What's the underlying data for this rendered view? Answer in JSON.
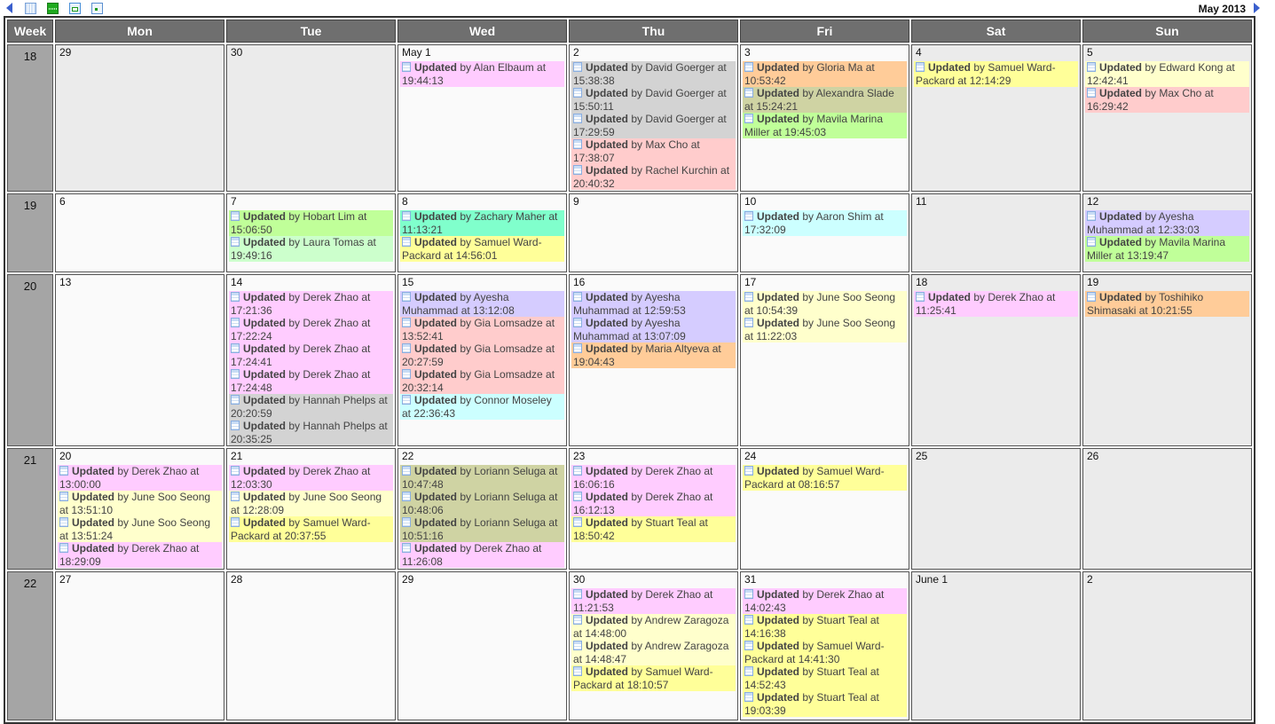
{
  "toolbar": {
    "prev_icon": "prev-month-arrow-icon",
    "next_icon": "next-month-arrow-icon",
    "view_icons": [
      "month-view-icon",
      "week-view-icon",
      "day-view-icon",
      "item-view-icon"
    ],
    "month_label": "May 2013"
  },
  "headers": [
    "Week",
    "Mon",
    "Tue",
    "Wed",
    "Thu",
    "Fri",
    "Sat",
    "Sun"
  ],
  "event_verb": "Updated",
  "colors": {
    "pink": "#ffccff",
    "gray": "#d3d3d3",
    "salmon": "#ffcccc",
    "orange": "#ffcc99",
    "olive": "#cfd3a3",
    "green": "#c0ff99",
    "yellow": "#ffff99",
    "lightyellow": "#ffffcc",
    "mint": "#ccffcc",
    "teal": "#80ffcc",
    "cyan": "#ccffff",
    "lavender": "#d5ccff"
  },
  "weeks": [
    {
      "week": "18",
      "days": [
        {
          "label": "29",
          "type": "other",
          "events": []
        },
        {
          "label": "30",
          "type": "other",
          "events": []
        },
        {
          "label": "May 1",
          "type": "day",
          "events": [
            {
              "text": " by Alan Elbaum at 19:44:13",
              "color": "pink"
            }
          ]
        },
        {
          "label": "2",
          "type": "day",
          "events": [
            {
              "text": " by David Goerger at 15:38:38",
              "color": "gray"
            },
            {
              "text": " by David Goerger at 15:50:11",
              "color": "gray"
            },
            {
              "text": " by David Goerger at 17:29:59",
              "color": "gray"
            },
            {
              "text": " by Max Cho at 17:38:07",
              "color": "salmon"
            },
            {
              "text": " by Rachel Kurchin at 20:40:32",
              "color": "salmon"
            }
          ]
        },
        {
          "label": "3",
          "type": "day",
          "events": [
            {
              "text": " by Gloria Ma at 10:53:42",
              "color": "orange"
            },
            {
              "text": " by Alexandra Slade at 15:24:21",
              "color": "olive"
            },
            {
              "text": " by Mavila Marina Miller at 19:45:03",
              "color": "green"
            }
          ]
        },
        {
          "label": "4",
          "type": "weekend",
          "events": [
            {
              "text": " by Samuel Ward-Packard at 12:14:29",
              "color": "yellow"
            }
          ]
        },
        {
          "label": "5",
          "type": "weekend",
          "events": [
            {
              "text": " by Edward Kong at 12:42:41",
              "color": "lightyellow"
            },
            {
              "text": " by Max Cho at 16:29:42",
              "color": "salmon"
            }
          ]
        }
      ]
    },
    {
      "week": "19",
      "days": [
        {
          "label": "6",
          "type": "day",
          "events": []
        },
        {
          "label": "7",
          "type": "day",
          "events": [
            {
              "text": " by Hobart Lim at 15:06:50",
              "color": "green"
            },
            {
              "text": " by Laura Tomas at 19:49:16",
              "color": "mint"
            }
          ]
        },
        {
          "label": "8",
          "type": "day",
          "events": [
            {
              "text": " by Zachary Maher at 11:13:21",
              "color": "teal"
            },
            {
              "text": " by Samuel Ward-Packard at 14:56:01",
              "color": "yellow"
            }
          ]
        },
        {
          "label": "9",
          "type": "day",
          "events": []
        },
        {
          "label": "10",
          "type": "day",
          "events": [
            {
              "text": " by Aaron Shim at 17:32:09",
              "color": "cyan"
            }
          ]
        },
        {
          "label": "11",
          "type": "weekend",
          "events": []
        },
        {
          "label": "12",
          "type": "weekend",
          "events": [
            {
              "text": " by Ayesha Muhammad at 12:33:03",
              "color": "lavender"
            },
            {
              "text": " by Mavila Marina Miller at 13:19:47",
              "color": "green"
            }
          ]
        }
      ]
    },
    {
      "week": "20",
      "days": [
        {
          "label": "13",
          "type": "day",
          "events": []
        },
        {
          "label": "14",
          "type": "day",
          "events": [
            {
              "text": " by Derek Zhao at 17:21:36",
              "color": "pink"
            },
            {
              "text": " by Derek Zhao at 17:22:24",
              "color": "pink"
            },
            {
              "text": " by Derek Zhao at 17:24:41",
              "color": "pink"
            },
            {
              "text": " by Derek Zhao at 17:24:48",
              "color": "pink"
            },
            {
              "text": " by Hannah Phelps at 20:20:59",
              "color": "gray"
            },
            {
              "text": " by Hannah Phelps at 20:35:25",
              "color": "gray"
            }
          ]
        },
        {
          "label": "15",
          "type": "day",
          "events": [
            {
              "text": " by Ayesha Muhammad at 13:12:08",
              "color": "lavender"
            },
            {
              "text": " by Gia Lomsadze at 13:52:41",
              "color": "salmon"
            },
            {
              "text": " by Gia Lomsadze at 20:27:59",
              "color": "salmon"
            },
            {
              "text": " by Gia Lomsadze at 20:32:14",
              "color": "salmon"
            },
            {
              "text": " by Connor Moseley at 22:36:43",
              "color": "cyan"
            }
          ]
        },
        {
          "label": "16",
          "type": "day",
          "events": [
            {
              "text": " by Ayesha Muhammad at 12:59:53",
              "color": "lavender"
            },
            {
              "text": " by Ayesha Muhammad at 13:07:09",
              "color": "lavender"
            },
            {
              "text": " by Maria Altyeva at 19:04:43",
              "color": "orange"
            }
          ]
        },
        {
          "label": "17",
          "type": "day",
          "events": [
            {
              "text": " by June Soo Seong at 10:54:39",
              "color": "lightyellow"
            },
            {
              "text": " by June Soo Seong at 11:22:03",
              "color": "lightyellow"
            }
          ]
        },
        {
          "label": "18",
          "type": "weekend",
          "events": [
            {
              "text": " by Derek Zhao at 11:25:41",
              "color": "pink"
            }
          ]
        },
        {
          "label": "19",
          "type": "weekend",
          "events": [
            {
              "text": " by Toshihiko Shimasaki at 10:21:55",
              "color": "orange"
            }
          ]
        }
      ]
    },
    {
      "week": "21",
      "days": [
        {
          "label": "20",
          "type": "day",
          "events": [
            {
              "text": " by Derek Zhao at 13:00:00",
              "color": "pink"
            },
            {
              "text": " by June Soo Seong at 13:51:10",
              "color": "lightyellow"
            },
            {
              "text": " by June Soo Seong at 13:51:24",
              "color": "lightyellow"
            },
            {
              "text": " by Derek Zhao at 18:29:09",
              "color": "pink"
            }
          ]
        },
        {
          "label": "21",
          "type": "day",
          "events": [
            {
              "text": " by Derek Zhao at 12:03:30",
              "color": "pink"
            },
            {
              "text": " by June Soo Seong at 12:28:09",
              "color": "lightyellow"
            },
            {
              "text": " by Samuel Ward-Packard at 20:37:55",
              "color": "yellow"
            }
          ]
        },
        {
          "label": "22",
          "type": "day",
          "events": [
            {
              "text": " by Loriann Seluga at 10:47:48",
              "color": "olive"
            },
            {
              "text": " by Loriann Seluga at 10:48:06",
              "color": "olive"
            },
            {
              "text": " by Loriann Seluga at 10:51:16",
              "color": "olive"
            },
            {
              "text": " by Derek Zhao at 11:26:08",
              "color": "pink"
            }
          ]
        },
        {
          "label": "23",
          "type": "day",
          "events": [
            {
              "text": " by Derek Zhao at 16:06:16",
              "color": "pink"
            },
            {
              "text": " by Derek Zhao at 16:12:13",
              "color": "pink"
            },
            {
              "text": " by Stuart Teal at 18:50:42",
              "color": "yellow"
            }
          ]
        },
        {
          "label": "24",
          "type": "day",
          "events": [
            {
              "text": " by Samuel Ward-Packard at 08:16:57",
              "color": "yellow"
            }
          ]
        },
        {
          "label": "25",
          "type": "weekend",
          "events": []
        },
        {
          "label": "26",
          "type": "weekend",
          "events": []
        }
      ]
    },
    {
      "week": "22",
      "days": [
        {
          "label": "27",
          "type": "day",
          "events": []
        },
        {
          "label": "28",
          "type": "day",
          "events": []
        },
        {
          "label": "29",
          "type": "day",
          "events": []
        },
        {
          "label": "30",
          "type": "day",
          "events": [
            {
              "text": " by Derek Zhao at 11:21:53",
              "color": "pink"
            },
            {
              "text": " by Andrew Zaragoza at 14:48:00",
              "color": "lightyellow"
            },
            {
              "text": " by Andrew Zaragoza at 14:48:47",
              "color": "lightyellow"
            },
            {
              "text": " by Samuel Ward-Packard at 18:10:57",
              "color": "yellow"
            }
          ]
        },
        {
          "label": "31",
          "type": "day",
          "events": [
            {
              "text": " by Derek Zhao at 14:02:43",
              "color": "pink"
            },
            {
              "text": " by Stuart Teal at 14:16:38",
              "color": "yellow"
            },
            {
              "text": " by Samuel Ward-Packard at 14:41:30",
              "color": "yellow"
            },
            {
              "text": " by Stuart Teal at 14:52:43",
              "color": "yellow"
            },
            {
              "text": " by Stuart Teal at 19:03:39",
              "color": "yellow"
            }
          ]
        },
        {
          "label": "June 1",
          "type": "other",
          "events": []
        },
        {
          "label": "2",
          "type": "other",
          "events": []
        }
      ]
    }
  ]
}
